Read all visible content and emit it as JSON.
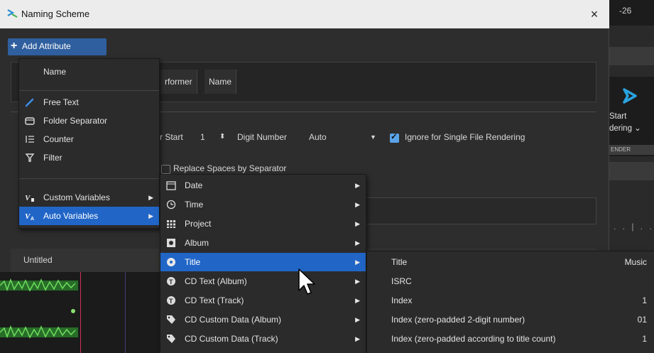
{
  "window": {
    "title": "Naming Scheme",
    "close": "×"
  },
  "toolbar": {
    "add_attribute": "Add Attribute"
  },
  "attributes_row": [
    "rformer",
    "Name"
  ],
  "options": {
    "start_label": "r Start",
    "start_value": "1",
    "digit_label": "Digit Number",
    "digit_value": "Auto",
    "ignore_label": "Ignore for Single File Rendering",
    "replace_label": "Replace Spaces by Separator"
  },
  "preset": {
    "name": "Untitled"
  },
  "background_app": {
    "top_number": "-26",
    "start_line1": "Start",
    "start_line2": "dering",
    "sub_label": "ENDER",
    "dots": ". . | . ."
  },
  "attribute_menu": {
    "header": "Name",
    "items": [
      {
        "label": "Free Text",
        "icon": "pen-icon"
      },
      {
        "label": "Folder Separator",
        "icon": "folder-icon"
      },
      {
        "label": "Counter",
        "icon": "counter-icon"
      },
      {
        "label": "Filter",
        "icon": "filter-icon"
      },
      {
        "label": "Custom Variables",
        "icon": "custom-variables-icon",
        "submenu": true
      },
      {
        "label": "Auto Variables",
        "icon": "auto-variables-icon",
        "submenu": true,
        "selected": true
      }
    ]
  },
  "auto_variables_menu": {
    "items": [
      {
        "label": "Date",
        "icon": "calendar-icon"
      },
      {
        "label": "Time",
        "icon": "clock-icon"
      },
      {
        "label": "Project",
        "icon": "project-grid-icon"
      },
      {
        "label": "Album",
        "icon": "album-icon"
      },
      {
        "label": "Title",
        "icon": "title-cd-icon",
        "selected": true
      },
      {
        "label": "CD Text (Album)",
        "icon": "cd-text-icon"
      },
      {
        "label": "CD Text (Track)",
        "icon": "cd-text-icon"
      },
      {
        "label": "CD Custom Data (Album)",
        "icon": "tag-icon"
      },
      {
        "label": "CD Custom Data (Track)",
        "icon": "tag-icon"
      }
    ]
  },
  "title_menu": {
    "items": [
      {
        "label": "Title",
        "value": "Music"
      },
      {
        "label": "ISRC",
        "value": ""
      },
      {
        "label": "Index",
        "value": "1"
      },
      {
        "label": "Index (zero-padded 2-digit number)",
        "value": "01"
      },
      {
        "label": "Index (zero-padded according to title count)",
        "value": "1"
      }
    ]
  },
  "colors": {
    "accent": "#2166c7",
    "button": "#2f5f9e",
    "checkbox": "#5aa3e8",
    "waveform": "#3fbf3f",
    "marker": "#d12c5a"
  }
}
